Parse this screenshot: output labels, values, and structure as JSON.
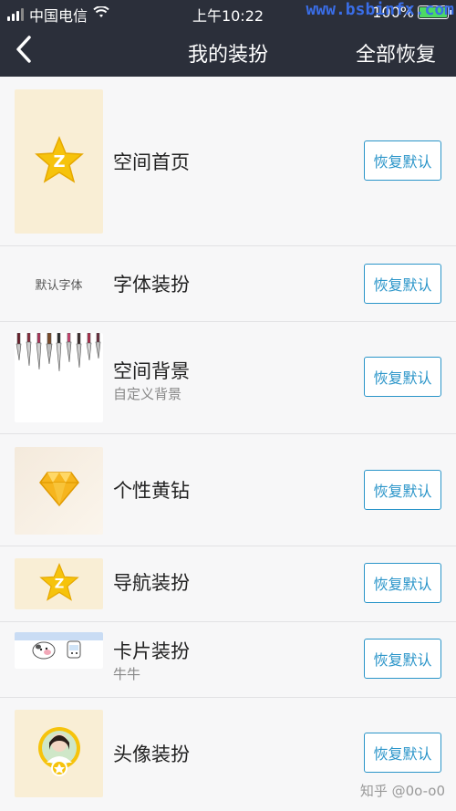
{
  "status_bar": {
    "carrier": "中国电信",
    "time": "上午10:22",
    "battery_text": "100%",
    "watermark": "www.bsbinfx.com"
  },
  "navbar": {
    "title": "我的装扮",
    "action": "全部恢复"
  },
  "items": [
    {
      "title": "空间首页",
      "subtitle": "",
      "button": "恢复默认",
      "thumb": "qzone-star"
    },
    {
      "title": "字体装扮",
      "subtitle": "",
      "button": "恢复默认",
      "thumb": "font",
      "thumb_text": "默认字体"
    },
    {
      "title": "空间背景",
      "subtitle": "自定义背景",
      "button": "恢复默认",
      "thumb": "knives"
    },
    {
      "title": "个性黄钻",
      "subtitle": "",
      "button": "恢复默认",
      "thumb": "diamond"
    },
    {
      "title": "导航装扮",
      "subtitle": "",
      "button": "恢复默认",
      "thumb": "qzone-star"
    },
    {
      "title": "卡片装扮",
      "subtitle": "牛牛",
      "button": "恢复默认",
      "thumb": "cow-cards"
    },
    {
      "title": "头像装扮",
      "subtitle": "",
      "button": "恢复默认",
      "thumb": "avatar-frame"
    }
  ],
  "footer_watermark": "知乎 @0o-o0",
  "colors": {
    "nav_bg": "#2b2f3a",
    "accent": "#2b95c9",
    "gold": "#f3b800"
  }
}
